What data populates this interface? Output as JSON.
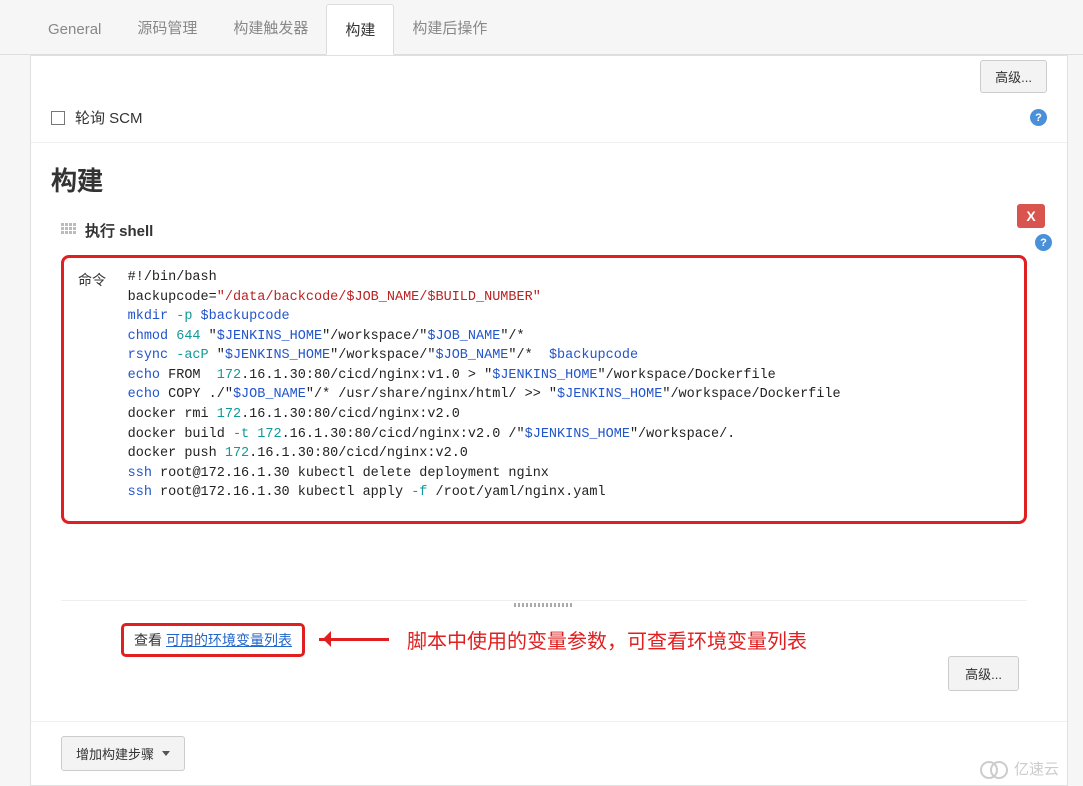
{
  "tabs": {
    "general": "General",
    "scm": "源码管理",
    "triggers": "构建触发器",
    "build": "构建",
    "post": "构建后操作"
  },
  "topAdvanced": "高级...",
  "pollSCM": "轮询 SCM",
  "sectionTitle": "构建",
  "step": {
    "title": "执行 shell",
    "close": "X",
    "commandLabel": "命令"
  },
  "envRow": {
    "prefix": "查看",
    "link": "可用的环境变量列表"
  },
  "note": "脚本中使用的变量参数，可查看环境变量列表",
  "advanced": "高级...",
  "addStep": "增加构建步骤",
  "watermark": "亿速云",
  "script": {
    "l1": "#!/bin/bash",
    "l2a": "backupcode=",
    "l2b": "\"/data/backcode/$JOB_NAME/$BUILD_NUMBER\"",
    "l3a": "mkdir ",
    "l3b": "-p",
    "l3c": " $backupcode",
    "l4a": "chmod ",
    "l4b": "644",
    "l4c": " \"",
    "l4d": "$JENKINS_HOME",
    "l4e": "\"/workspace/\"",
    "l4f": "$JOB_NAME",
    "l4g": "\"/*",
    "l5a": "rsync ",
    "l5b": "-acP",
    "l5c": " \"",
    "l5d": "$JENKINS_HOME",
    "l5e": "\"/workspace/\"",
    "l5f": "$JOB_NAME",
    "l5g": "\"/*  ",
    "l5h": "$backupcode",
    "l6a": "echo",
    "l6b": " FROM  ",
    "l6c": "172",
    "l6d": ".16.1.30:80/cicd/nginx:v1.0 > \"",
    "l6e": "$JENKINS_HOME",
    "l6f": "\"/workspace/Dockerfile",
    "l7a": "echo",
    "l7b": " COPY ./\"",
    "l7c": "$JOB_NAME",
    "l7d": "\"/* /usr/share/nginx/html/ >> \"",
    "l7e": "$JENKINS_HOME",
    "l7f": "\"/workspace/Dockerfile",
    "l8a": "docker rmi ",
    "l8b": "172",
    "l8c": ".16.1.30:80/cicd/nginx:v2.0",
    "l9a": "docker build ",
    "l9b": "-t",
    "l9c": " ",
    "l9d": "172",
    "l9e": ".16.1.30:80/cicd/nginx:v2.0 /\"",
    "l9f": "$JENKINS_HOME",
    "l9g": "\"/workspace/.",
    "l10a": "docker push ",
    "l10b": "172",
    "l10c": ".16.1.30:80/cicd/nginx:v2.0",
    "l11a": "ssh",
    "l11b": " root@172.16.1.30 kubectl delete deployment nginx",
    "l12a": "ssh",
    "l12b": " root@172.16.1.30 kubectl apply ",
    "l12c": "-f",
    "l12d": " /root/yaml/nginx.yaml"
  }
}
